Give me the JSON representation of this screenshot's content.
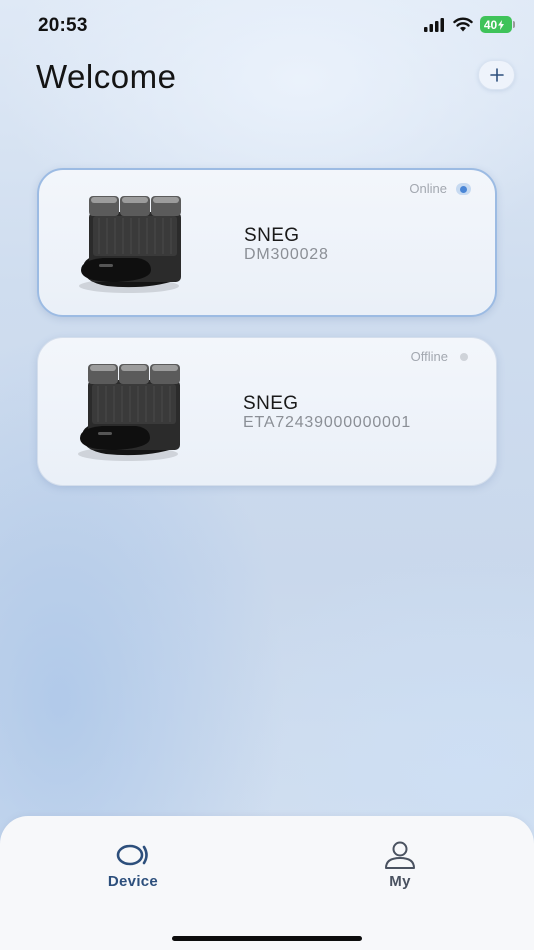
{
  "status_bar": {
    "time": "20:53",
    "battery_level": "40"
  },
  "header": {
    "title": "Welcome",
    "add_button_icon": "plus-icon"
  },
  "devices": [
    {
      "name": "SNEG",
      "serial": "DM300028",
      "status": "Online",
      "status_color": "#4a86d6"
    },
    {
      "name": "SNEG",
      "serial": "ETA72439000000001",
      "status": "Offline",
      "status_color": "#cfd3d9"
    }
  ],
  "tab_bar": {
    "tabs": [
      {
        "label": "Device",
        "icon": "device-tab-icon",
        "active": true
      },
      {
        "label": "My",
        "icon": "person-icon",
        "active": false
      }
    ]
  },
  "colors": {
    "accent": "#2d4f7c",
    "online_border": "#9cbbe3",
    "battery": "#3fc35a"
  }
}
